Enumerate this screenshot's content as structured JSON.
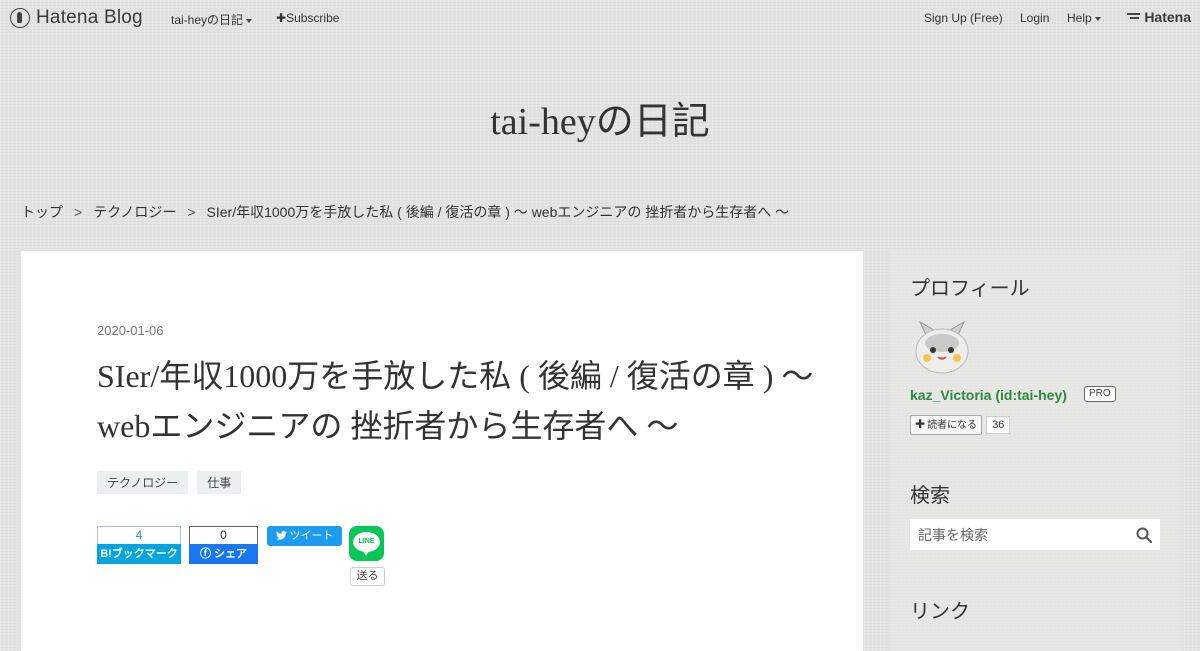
{
  "topbar": {
    "logo": "Hatena Blog",
    "blog_menu": "tai-heyの日記",
    "subscribe": "Subscribe",
    "signup": "Sign Up (Free)",
    "login": "Login",
    "help": "Help",
    "brand": "Hatena"
  },
  "blog": {
    "title": "tai-heyの日記"
  },
  "breadcrumb": [
    "トップ",
    "テクノロジー",
    "SIer/年収1000万を手放した私 ( 後編 / 復活の章 ) 〜 webエンジニアの 挫折者から生存者へ 〜"
  ],
  "article": {
    "date": "2020-01-06",
    "title": "SIer/年収1000万を手放した私 ( 後編 / 復活の章 ) 〜 webエンジニアの 挫折者から生存者へ 〜",
    "categories": [
      "テクノロジー",
      "仕事"
    ],
    "share": {
      "hatena_count": "4",
      "hatena_label": "B!ブックマーク",
      "facebook_count": "0",
      "facebook_label": "シェア",
      "twitter_label": "ツイート",
      "line_logo": "LINE",
      "line_label": "送る"
    }
  },
  "sidebar": {
    "profile_heading": "プロフィール",
    "username": "kaz_Victoria (id:tai-hey)",
    "pro_badge": "PRO",
    "follow_label": "読者になる",
    "follow_count": "36",
    "search_heading": "検索",
    "search_placeholder": "記事を検索",
    "links_heading": "リンク"
  },
  "colors": {
    "hatena_bookmark": "#00a4de",
    "facebook": "#1877f2",
    "twitter": "#1d9bf0",
    "line": "#06c755",
    "username": "#2b8a3e"
  }
}
